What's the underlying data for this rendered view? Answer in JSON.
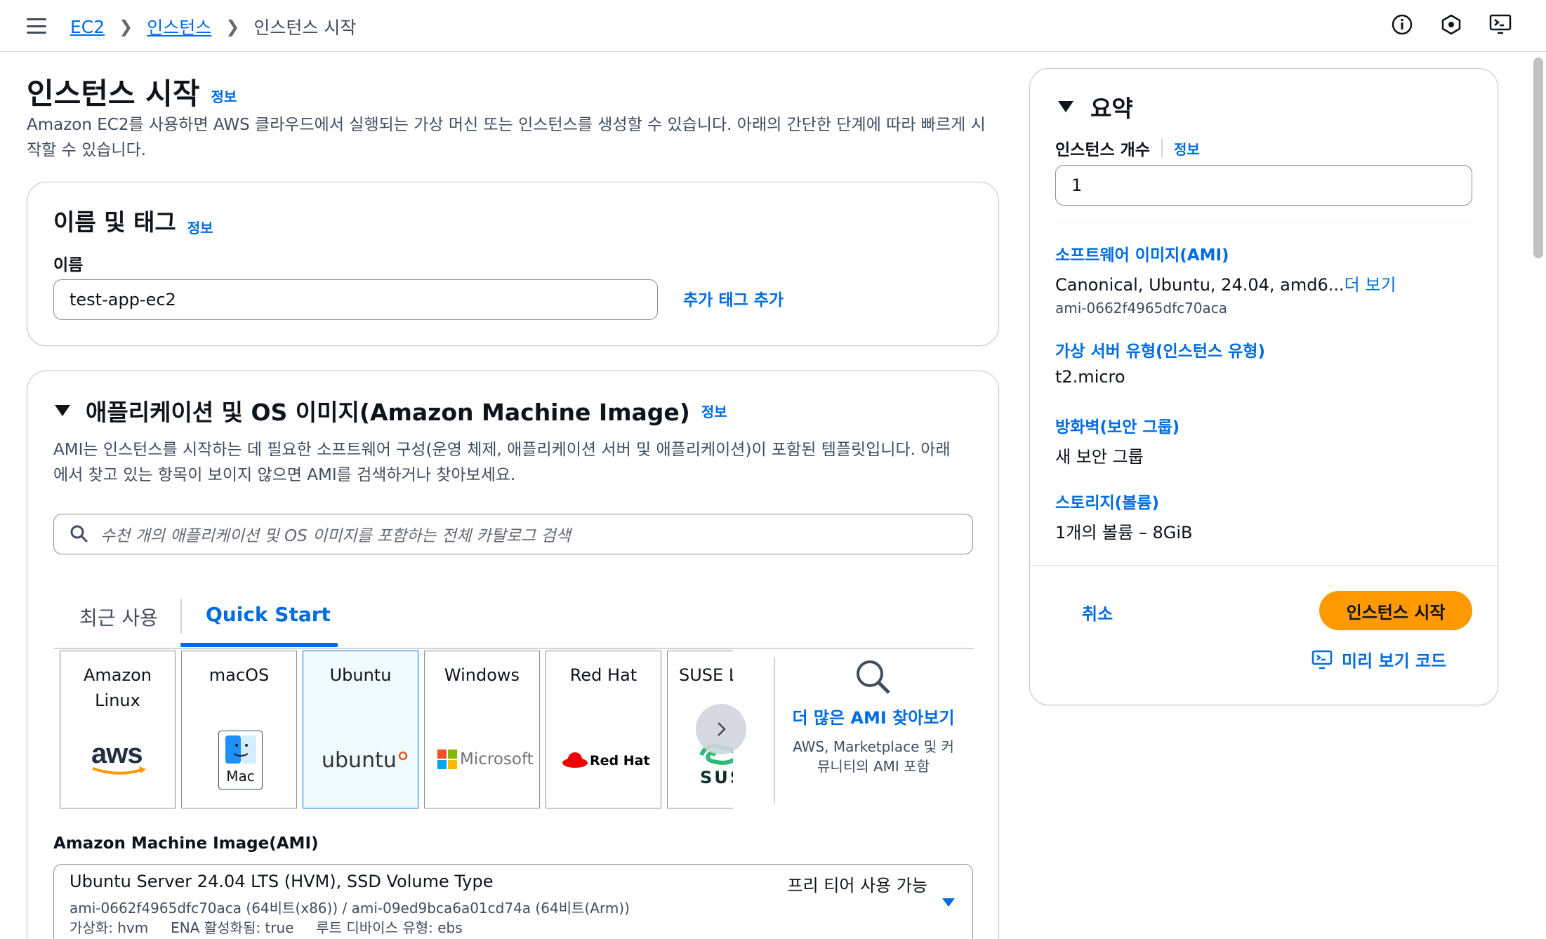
{
  "breadcrumb": {
    "items": [
      "EC2",
      "인스턴스"
    ],
    "current": "인스턴스 시작"
  },
  "page": {
    "title": "인스턴스 시작",
    "info": "정보",
    "desc_line1": "Amazon EC2를 사용하면 AWS 클라우드에서 실행되는 가상 머신 또는 인스턴스를 생성할 수 있습니다. 아래의 간단한 단계에 따라 빠르게 시",
    "desc_line2": "작할 수 있습니다."
  },
  "name_tags": {
    "title": "이름 및 태그",
    "info": "정보",
    "name_label": "이름",
    "name_value": "test-app-ec2",
    "add_tag": "추가 태그 추가"
  },
  "ami_section": {
    "title": "애플리케이션 및 OS 이미지(Amazon Machine Image)",
    "info": "정보",
    "desc_line1": "AMI는 인스턴스를 시작하는 데 필요한 소프트웨어 구성(운영 체제, 애플리케이션 서버 및 애플리케이션)이 포함된 템플릿입니다. 아래",
    "desc_line2": "에서 찾고 있는 항목이 보이지 않으면 AMI를 검색하거나 찾아보세요.",
    "search_placeholder": "수천 개의 애플리케이션 및 OS 이미지를 포함하는 전체 카탈로그 검색",
    "tabs": [
      "최근 사용",
      "Quick Start"
    ],
    "active_tab": "Quick Start",
    "os_tiles": [
      {
        "name": "Amazon\nLinux",
        "logo": "aws"
      },
      {
        "name": "macOS",
        "logo": "Mac"
      },
      {
        "name": "Ubuntu",
        "logo": "ubuntu"
      },
      {
        "name": "Windows",
        "logo": "Microsoft"
      },
      {
        "name": "Red Hat",
        "logo": "Red Hat"
      },
      {
        "name": "SUSE L",
        "logo": "SUS"
      }
    ],
    "selected_os": "Ubuntu",
    "browse_more": "더 많은 AMI 찾아보기",
    "browse_desc_line1": "AWS, Marketplace 및 커",
    "browse_desc_line2": "뮤니티의 AMI 포함",
    "ami_label": "Amazon Machine Image(AMI)",
    "ami_name": "Ubuntu Server 24.04 LTS (HVM), SSD Volume Type",
    "ami_ids": "ami-0662f4965dfc70aca (64비트(x86)) / ami-09ed9bca6a01cd74a (64비트(Arm))",
    "ami_meta": "가상화: hvm     ENA 활성화됨: true     루트 디바이스 유형: ebs",
    "free_tier": "프리 티어 사용 가능"
  },
  "summary": {
    "title": "요약",
    "count_label": "인스턴스 개수",
    "info": "정보",
    "count_value": "1",
    "ami_title": "소프트웨어 이미지(AMI)",
    "ami_value": "Canonical, Ubuntu, 24.04, amd6...",
    "ami_more": "더 보기",
    "ami_id": "ami-0662f4965dfc70aca",
    "type_title": "가상 서버 유형(인스턴스 유형)",
    "type_value": "t2.micro",
    "sg_title": "방화벽(보안 그룹)",
    "sg_value": "새 보안 그룹",
    "storage_title": "스토리지(볼륨)",
    "storage_value": "1개의 볼륨 – 8GiB",
    "cancel": "취소",
    "launch": "인스턴스 시작",
    "preview": "미리 보기 코드"
  },
  "colors": {
    "accent": "#006ce0",
    "primary_button": "#ff9900"
  }
}
